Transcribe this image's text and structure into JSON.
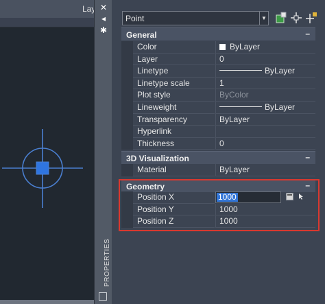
{
  "drawing": {
    "layer_label": "Laye",
    "colors": {
      "background": "#212830",
      "marker": "#4a7fd0",
      "marker_fill": "#2f75e0"
    }
  },
  "palette": {
    "title": "PROPERTIES",
    "close_glyph": "✕",
    "autohide_glyph": "◂",
    "settings_glyph": "✱"
  },
  "header": {
    "selection": "Point",
    "icons": [
      "quick-select-icon",
      "select-objects-icon",
      "toggle-pickadd-icon"
    ]
  },
  "sections": {
    "general": {
      "title": "General",
      "collapse": "–",
      "rows": [
        {
          "name": "Color",
          "value": "ByLayer"
        },
        {
          "name": "Layer",
          "value": "0"
        },
        {
          "name": "Linetype",
          "value": "ByLayer"
        },
        {
          "name": "Linetype scale",
          "value": "1"
        },
        {
          "name": "Plot style",
          "value": "ByColor"
        },
        {
          "name": "Lineweight",
          "value": "ByLayer"
        },
        {
          "name": "Transparency",
          "value": "ByLayer"
        },
        {
          "name": "Hyperlink",
          "value": ""
        },
        {
          "name": "Thickness",
          "value": "0"
        }
      ]
    },
    "visualization": {
      "title": "3D Visualization",
      "collapse": "–",
      "rows": [
        {
          "name": "Material",
          "value": "ByLayer"
        }
      ]
    },
    "geometry": {
      "title": "Geometry",
      "collapse": "–",
      "rows": [
        {
          "name": "Position X",
          "value": "1000"
        },
        {
          "name": "Position Y",
          "value": "1000"
        },
        {
          "name": "Position Z",
          "value": "1000"
        }
      ]
    }
  },
  "highlight_color": "#d9382f"
}
